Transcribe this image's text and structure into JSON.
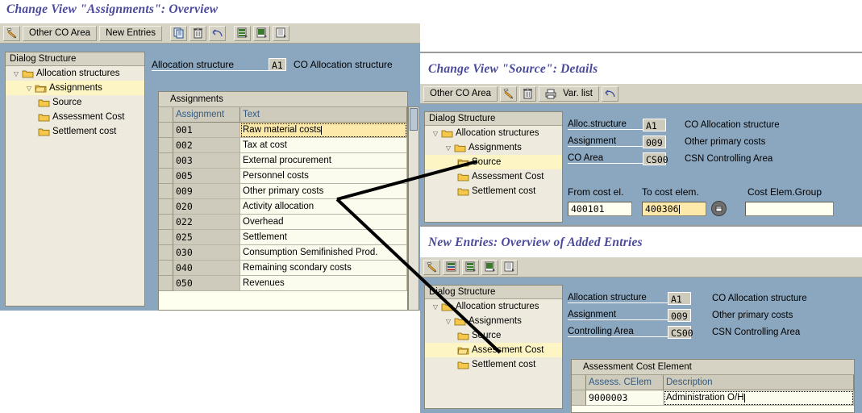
{
  "window1": {
    "title": "Change View \"Assignments\": Overview",
    "toolbar": [
      {
        "name": "display-change-button",
        "icon": "pencil-glasses-icon",
        "label": ""
      },
      {
        "name": "other-co-area-button",
        "icon": "",
        "label": "Other CO Area"
      },
      {
        "name": "new-entries-button",
        "icon": "",
        "label": "New Entries"
      },
      {
        "name": "copy-button",
        "icon": "copy-icon",
        "label": ""
      },
      {
        "name": "delete-button",
        "icon": "trash-icon",
        "label": ""
      },
      {
        "name": "undo-button",
        "icon": "undo-arrow-icon",
        "label": ""
      },
      {
        "name": "select-all-button",
        "icon": "table-select-icon",
        "label": ""
      },
      {
        "name": "select-block-button",
        "icon": "table-block-icon",
        "label": ""
      },
      {
        "name": "deselect-all-button",
        "icon": "table-deselect-icon",
        "label": ""
      }
    ],
    "tree": {
      "header": "Dialog Structure",
      "nodes": [
        {
          "label": "Allocation structures",
          "indent": 1,
          "twisty": "open",
          "selected": false
        },
        {
          "label": "Assignments",
          "indent": 2,
          "twisty": "open",
          "selected": true
        },
        {
          "label": "Source",
          "indent": 3,
          "twisty": "",
          "selected": false
        },
        {
          "label": "Assessment Cost",
          "indent": 3,
          "twisty": "",
          "selected": false
        },
        {
          "label": "Settlement cost",
          "indent": 3,
          "twisty": "",
          "selected": false
        }
      ]
    },
    "header_field": {
      "label": "Allocation structure",
      "key": "A1",
      "desc": "CO Allocation structure"
    },
    "grid": {
      "caption": "Assignments",
      "columns": [
        "Assignment",
        "Text"
      ],
      "rows": [
        {
          "assignment": "001",
          "text": "Raw material costs",
          "edit": true
        },
        {
          "assignment": "002",
          "text": "Tax at cost",
          "edit": false
        },
        {
          "assignment": "003",
          "text": "External procurement",
          "edit": false
        },
        {
          "assignment": "005",
          "text": "Personnel costs",
          "edit": false
        },
        {
          "assignment": "009",
          "text": "Other primary costs",
          "edit": false
        },
        {
          "assignment": "020",
          "text": "Activity allocation",
          "edit": false
        },
        {
          "assignment": "022",
          "text": "Overhead",
          "edit": false
        },
        {
          "assignment": "025",
          "text": "Settlement",
          "edit": false
        },
        {
          "assignment": "030",
          "text": "Consumption Semifinished Prod.",
          "edit": false
        },
        {
          "assignment": "040",
          "text": "Remaining scondary costs",
          "edit": false
        },
        {
          "assignment": "050",
          "text": "Revenues",
          "edit": false
        }
      ]
    }
  },
  "window2": {
    "title": "Change View \"Source\": Details",
    "toolbar": [
      {
        "name": "other-co-area-button",
        "icon": "",
        "label": "Other CO Area"
      },
      {
        "name": "display-change-button",
        "icon": "pencil-glasses-icon",
        "label": ""
      },
      {
        "name": "delete-button",
        "icon": "trash-icon",
        "label": ""
      },
      {
        "name": "var-list-button",
        "icon": "printer-icon",
        "label": "Var. list"
      },
      {
        "name": "undo-button",
        "icon": "undo-arrow-icon",
        "label": ""
      }
    ],
    "tree": {
      "header": "Dialog Structure",
      "nodes": [
        {
          "label": "Allocation structures",
          "indent": 1,
          "twisty": "open",
          "selected": false
        },
        {
          "label": "Assignments",
          "indent": 2,
          "twisty": "open",
          "selected": false
        },
        {
          "label": "Source",
          "indent": 3,
          "twisty": "",
          "selected": true
        },
        {
          "label": "Assessment Cost",
          "indent": 3,
          "twisty": "",
          "selected": false
        },
        {
          "label": "Settlement cost",
          "indent": 3,
          "twisty": "",
          "selected": false
        }
      ]
    },
    "fields": [
      {
        "label": "Alloc.structure",
        "key": "A1",
        "desc": "CO Allocation structure"
      },
      {
        "label": "Assignment",
        "key": "009",
        "desc": "Other primary costs"
      },
      {
        "label": "CO Area",
        "key": "CS00",
        "desc": "CSN Controlling Area"
      }
    ],
    "costels": {
      "from_label": "From cost el.",
      "to_label": "To cost elem.",
      "group_label": "Cost Elem.Group",
      "from_value": "400101",
      "to_value": "400306",
      "group_value": ""
    }
  },
  "window3": {
    "title": "New Entries: Overview of Added Entries",
    "toolbar": [
      {
        "name": "display-change-button",
        "icon": "pencil-glasses-icon",
        "label": ""
      },
      {
        "name": "delete-row-button",
        "icon": "table-delete-icon",
        "label": ""
      },
      {
        "name": "select-all-button",
        "icon": "table-select-icon",
        "label": ""
      },
      {
        "name": "select-block-button",
        "icon": "table-block-icon",
        "label": ""
      },
      {
        "name": "deselect-all-button",
        "icon": "table-deselect-icon",
        "label": ""
      }
    ],
    "tree": {
      "header": "Dialog Structure",
      "nodes": [
        {
          "label": "Allocation structures",
          "indent": 1,
          "twisty": "open",
          "selected": false
        },
        {
          "label": "Assignments",
          "indent": 2,
          "twisty": "open",
          "selected": false
        },
        {
          "label": "Source",
          "indent": 3,
          "twisty": "",
          "selected": false
        },
        {
          "label": "Assessment Cost",
          "indent": 3,
          "twisty": "",
          "selected": true
        },
        {
          "label": "Settlement cost",
          "indent": 3,
          "twisty": "",
          "selected": false
        }
      ]
    },
    "fields": [
      {
        "label": "Allocation structure",
        "key": "A1",
        "desc": "CO Allocation structure"
      },
      {
        "label": "Assignment",
        "key": "009",
        "desc": "Other primary costs"
      },
      {
        "label": "Controlling Area",
        "key": "CS00",
        "desc": "CSN Controlling Area"
      }
    ],
    "grid": {
      "caption": "Assessment Cost Element",
      "columns": [
        "Assess. CElem",
        "Description"
      ],
      "rows": [
        {
          "celem": "9000003",
          "description": "Administration O/H",
          "focus": true
        }
      ]
    }
  },
  "colors": {
    "title_blue": "#4a4a9c",
    "toolbar_bg": "#d7d3c4",
    "screen_bg": "#8ba7bf",
    "tree_bg": "#eeeade",
    "selected_row": "#fdf6c4",
    "edit_field": "#fde9a9",
    "grid_header_text": "#315a82"
  }
}
